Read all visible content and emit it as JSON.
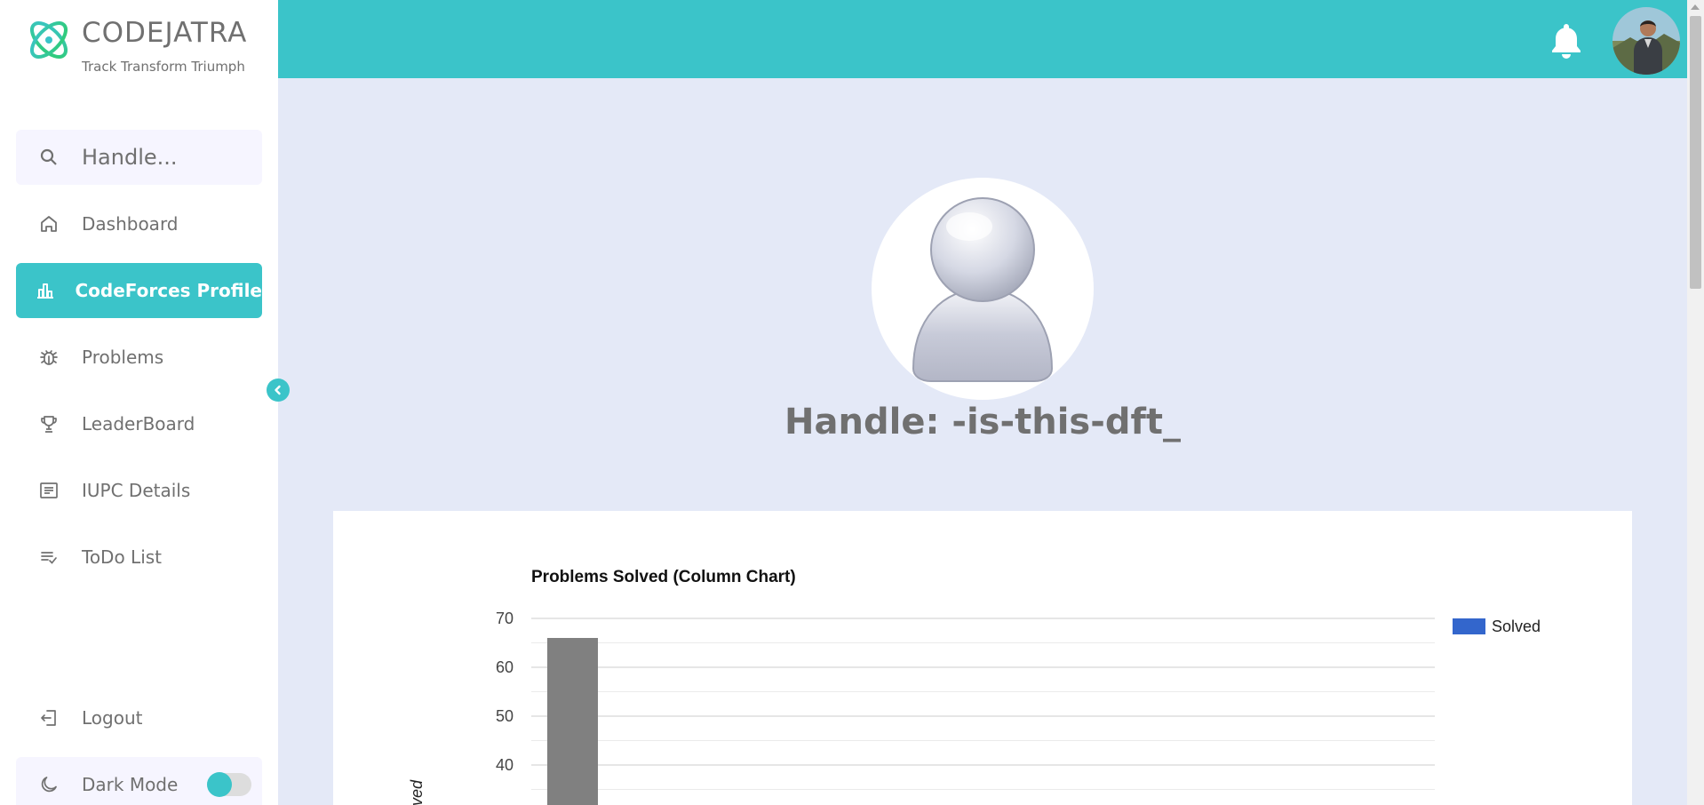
{
  "brand": {
    "name": "CODEJATRA",
    "tagline": "Track Transform Triumph",
    "logo_icon": "atom-logo-icon"
  },
  "search": {
    "placeholder": "Handle..."
  },
  "nav": {
    "items": [
      {
        "label": "Dashboard",
        "icon": "home-icon"
      },
      {
        "label": "CodeForces Profile",
        "icon": "bar-chart-icon",
        "active": true
      },
      {
        "label": "Problems",
        "icon": "bug-icon"
      },
      {
        "label": "LeaderBoard",
        "icon": "trophy-icon"
      },
      {
        "label": "IUPC Details",
        "icon": "document-icon"
      },
      {
        "label": "ToDo List",
        "icon": "checklist-icon"
      }
    ],
    "logout": {
      "label": "Logout",
      "icon": "logout-icon"
    },
    "dark_mode": {
      "label": "Dark Mode",
      "icon": "moon-icon",
      "enabled": false
    }
  },
  "colors": {
    "accent": "#3bc4c9",
    "background": "#e4e9f7",
    "text": "#707070",
    "bar": "#808080",
    "legend": "#3366cc"
  },
  "profile": {
    "handle_text": "Handle: -is-this-dft_"
  },
  "chart_data": {
    "type": "bar",
    "title": "Problems Solved (Column Chart)",
    "ylabel": "olved",
    "ylim": [
      30,
      70
    ],
    "yticks": [
      70,
      60,
      50,
      40
    ],
    "legend": {
      "label": "Solved",
      "position": "right"
    },
    "grid": true,
    "series": [
      {
        "name": "Solved",
        "values": [
          66
        ]
      }
    ]
  }
}
